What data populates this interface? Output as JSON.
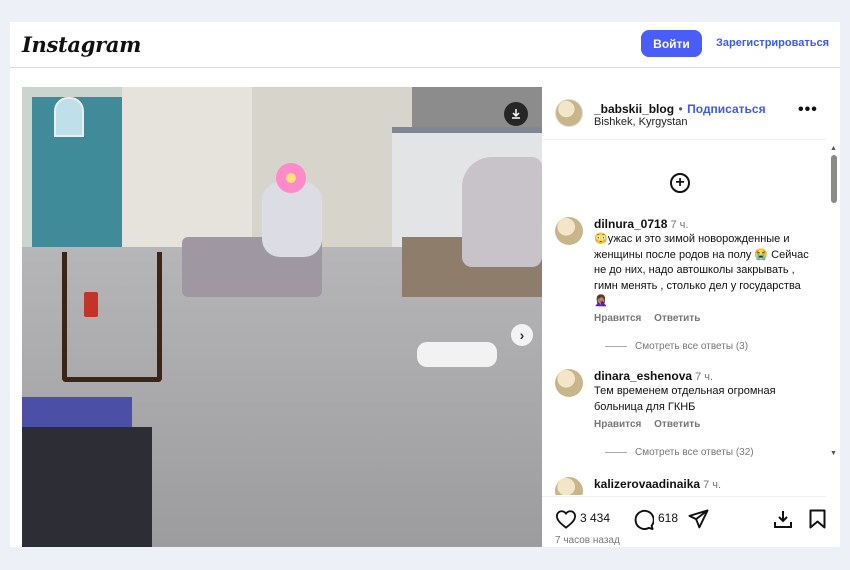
{
  "header": {
    "logo": "Instagram",
    "login_label": "Войти",
    "signup_label": "Зарегистрироваться"
  },
  "post": {
    "username": "_babskii_blog",
    "separator": "•",
    "follow_label": "Подписаться",
    "location": "Bishkek, Kyrgystan",
    "more_label": "•••",
    "likes": "3 434",
    "comments_count": "618",
    "time_ago": "7 часов назад"
  },
  "comments": [
    {
      "username": "dilnura_0718",
      "time": "7 ч.",
      "text": "😳ужас и это зимой новорожденные и женщины после родов на полу 😭 Сейчас не до них, надо автошколы закрывать , гимн менять , столько дел у государства 🤦🏽‍♀️",
      "reply_label": "Нравится",
      "answer_label": "Ответить",
      "view_replies": "Смотреть все ответы (3)"
    },
    {
      "username": "dinara_eshenova",
      "time": "7 ч.",
      "text": "Тем временем отдельная огромная больница для ГКНБ",
      "reply_label": "Нравится",
      "answer_label": "Ответить",
      "view_replies": "Смотреть все ответы (32)"
    },
    {
      "username": "kalizerovaadinaika",
      "time": "7 ч.",
      "text": ""
    }
  ],
  "icons": {
    "download": "download-icon",
    "next": "chevron-right-icon",
    "add": "plus-circle-icon",
    "like": "heart-icon",
    "comment": "comment-icon",
    "share": "send-icon",
    "save_post": "save-download-icon",
    "bookmark": "bookmark-icon"
  },
  "colors": {
    "accent": "#4a5df6",
    "link": "#3b5bf0",
    "background": "#eef0f7"
  }
}
